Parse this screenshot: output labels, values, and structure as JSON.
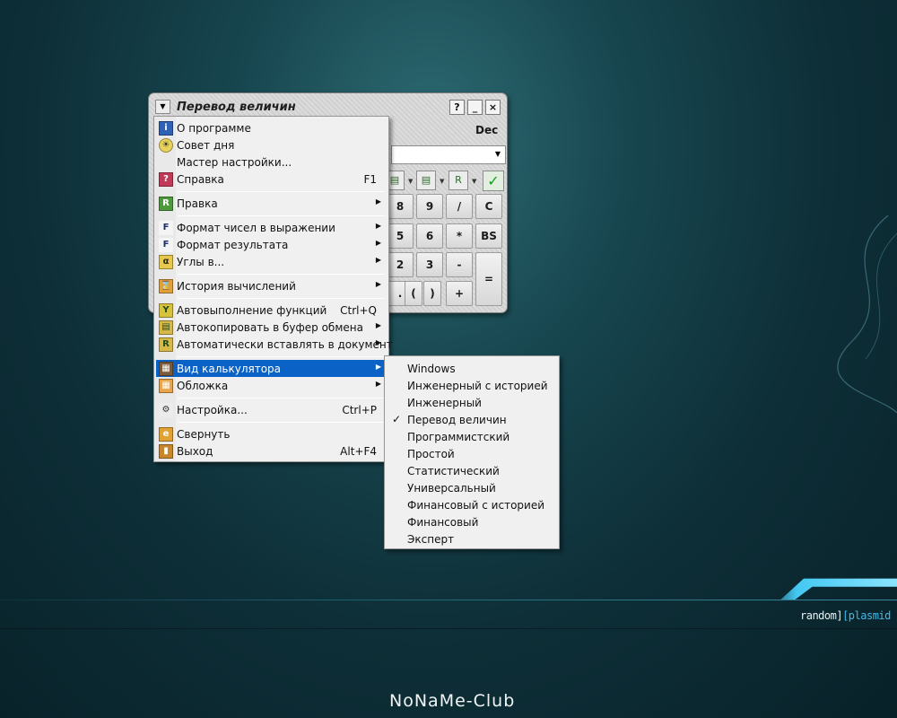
{
  "colors": {
    "menu_highlight": "#0a62c6",
    "check_green": "#14a01a",
    "wallpaper_accent": "#43b8e6"
  },
  "desktop": {
    "wallpaper_label_a": "random]",
    "wallpaper_label_b": "[plasmid",
    "watermark": "NoNaMe-Club"
  },
  "calculator": {
    "title": "Перевод величин",
    "mode": "Dec",
    "caption_buttons": [
      "?",
      "_",
      "×"
    ],
    "keys": [
      "8",
      "9",
      "/",
      "C",
      "5",
      "6",
      "*",
      "BS",
      "2",
      "3",
      "-",
      "=",
      ".",
      "(",
      ")",
      "+"
    ]
  },
  "menu": {
    "items": [
      {
        "label": "О программе",
        "shortcut": "",
        "icon": "info-icon"
      },
      {
        "label": "Совет дня",
        "shortcut": "",
        "icon": "lightbulb-icon"
      },
      {
        "label": "Мастер настройки...",
        "shortcut": "",
        "icon": ""
      },
      {
        "label": "Справка",
        "shortcut": "F1",
        "icon": "help-book-icon"
      },
      {
        "label": "Правка",
        "shortcut": "",
        "icon": "edit-icon"
      },
      {
        "label": "Формат чисел в выражении",
        "shortcut": "",
        "icon": "format-expression-icon"
      },
      {
        "label": "Формат результата",
        "shortcut": "",
        "icon": "format-result-icon"
      },
      {
        "label": "Углы в...",
        "shortcut": "",
        "icon": "alpha-angle-icon"
      },
      {
        "label": "История вычислений",
        "shortcut": "",
        "icon": "history-icon"
      },
      {
        "label": "Автовыполнение функций",
        "shortcut": "Ctrl+Q",
        "icon": "autorun-icon"
      },
      {
        "label": "Автокопировать в буфер обмена",
        "shortcut": "",
        "icon": "autocopy-icon"
      },
      {
        "label": "Автоматически вставлять в документ",
        "shortcut": "",
        "icon": "autoinsert-icon"
      },
      {
        "label": "Вид калькулятора",
        "shortcut": "",
        "icon": "calculator-view-icon"
      },
      {
        "label": "Обложка",
        "shortcut": "",
        "icon": "skin-icon"
      },
      {
        "label": "Настройка...",
        "shortcut": "Ctrl+P",
        "icon": "gears-icon"
      },
      {
        "label": "Свернуть",
        "shortcut": "",
        "icon": "minimize-icon"
      },
      {
        "label": "Выход",
        "shortcut": "Alt+F4",
        "icon": "exit-door-icon"
      }
    ]
  },
  "submenu": {
    "items": [
      "Windows",
      "Инженерный с историей",
      "Инженерный",
      "Перевод величин",
      "Программистский",
      "Простой",
      "Статистический",
      "Универсальный",
      "Финансовый с историей",
      "Финансовый",
      "Эксперт"
    ],
    "checked_index": 3
  }
}
